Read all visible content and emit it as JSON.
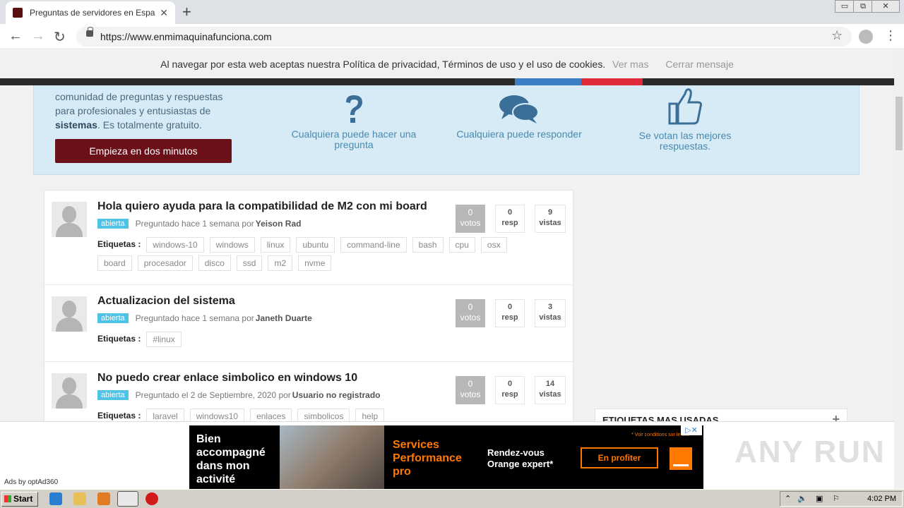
{
  "browser": {
    "tab_title": "Preguntas de servidores en Español",
    "tab_close": "✕",
    "new_tab": "+",
    "url": "https://www.enmimaquinafunciona.com",
    "win_min": "▭",
    "win_max": "⧉",
    "win_close": "✕"
  },
  "cookie_bar": {
    "text": "Al navegar por esta web aceptas nuestra Política de privacidad, Términos de uso y el uso de cookies.",
    "more_link": "Ver mas",
    "close_link": "Cerrar mensaje"
  },
  "hero": {
    "line1": "comunidad de preguntas y respuestas",
    "line2": "para profesionales y entusiastas de",
    "bold": "sistemas",
    "line3": ". Es totalmente gratuito.",
    "cta": "Empieza en dos minutos",
    "features": [
      {
        "icon": "question-mark-icon",
        "label": "Cualquiera puede hacer una pregunta"
      },
      {
        "icon": "chat-bubbles-icon",
        "label": "Cualquiera puede responder"
      },
      {
        "icon": "thumbs-up-icon",
        "label": "Se votan las mejores respuestas."
      }
    ]
  },
  "questions": [
    {
      "title": "Hola quiero ayuda para la compatibilidad de M2 con mi board",
      "status": "abierta",
      "asked": "Preguntado hace 1 semana por",
      "user": "Yeison Rad",
      "tags_label": "Etiquetas :",
      "tags": [
        "windows-10",
        "windows",
        "linux",
        "ubuntu",
        "command-line",
        "bash",
        "cpu",
        "osx",
        "board",
        "procesador",
        "disco",
        "ssd",
        "m2",
        "nvme"
      ],
      "votes": "0",
      "votes_label": "votos",
      "answers": "0",
      "answers_label": "resp",
      "views": "9",
      "views_label": "vistas"
    },
    {
      "title": "Actualizacion del sistema",
      "status": "abierta",
      "asked": "Preguntado hace 1 semana por",
      "user": "Janeth Duarte",
      "tags_label": "Etiquetas :",
      "tags": [
        "#linux"
      ],
      "votes": "0",
      "votes_label": "votos",
      "answers": "0",
      "answers_label": "resp",
      "views": "3",
      "views_label": "vistas"
    },
    {
      "title": "No puedo crear enlace simbolico en windows 10",
      "status": "abierta",
      "asked": "Preguntado el 2 de Septiembre, 2020 por",
      "user": "Usuario no registrado",
      "tags_label": "Etiquetas :",
      "tags": [
        "laravel",
        "windows10",
        "enlaces",
        "simbolicos",
        "help"
      ],
      "votes": "0",
      "votes_label": "votos",
      "answers": "0",
      "answers_label": "resp",
      "views": "14",
      "views_label": "vistas"
    }
  ],
  "sidebar": {
    "heading": "ETIQUETAS MAS USADAS",
    "toggle": "+"
  },
  "ad": {
    "left_text": "Bien accompagné dans mon activité",
    "orange_text": "Services Performance pro",
    "white_text": "Rendez-vous Orange expert*",
    "cta": "En profiter",
    "conditions": "* Voir conditions sur le site",
    "adchoices": "▷✕",
    "ads_by": "Ads by optAd360",
    "watermark": "ANY RUN"
  },
  "taskbar": {
    "start": "Start",
    "clock": "4:02 PM"
  }
}
